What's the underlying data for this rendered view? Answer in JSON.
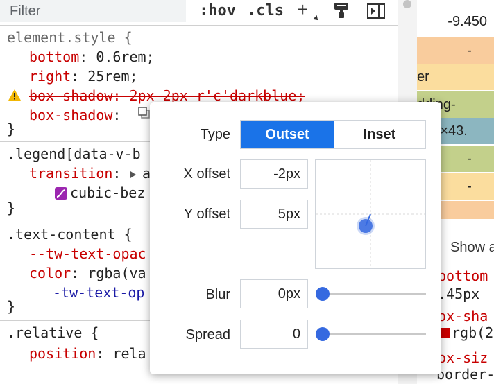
{
  "toolbar": {
    "filter_placeholder": "Filter",
    "hov_label": ":hov",
    "cls_label": ".cls",
    "add_label": "+"
  },
  "styles": {
    "element_style": {
      "selector": "element.style {",
      "bottom_prop": "bottom",
      "bottom_val": ": 0.6rem;",
      "right_prop": "right",
      "right_val": ": 25rem;",
      "invalid_text": "box-shadow: 2px 2px r'c'darkblue;",
      "box_shadow_prop": "box-shadow",
      "box_shadow_colon": ":",
      "close": "}"
    },
    "legend": {
      "selector": ".legend[data-v-b",
      "transition_prop": "transition",
      "transition_colon": ":",
      "transition_val_a": "a",
      "bezier_text": "cubic-bez",
      "close": "}"
    },
    "text_content": {
      "selector": ".text-content {",
      "var_prop": "--tw-text-opac",
      "color_prop": "color",
      "color_val": ": rgba(va",
      "var_ref": "-tw-text-op",
      "close": "}"
    },
    "relative": {
      "selector": ".relative {",
      "position_prop": "position",
      "position_val": ": rela"
    }
  },
  "computed": {
    "rows": [
      "-9.450",
      "-",
      "er",
      "dding",
      "148×43.",
      "-",
      "-",
      "-"
    ],
    "show_all": "Show a",
    "bottom_label": "bottom",
    "bottom_value": ".45px",
    "box_shadow_label": "ox-sha",
    "rgb_value": "rgb(2",
    "box_sizing_label": "ox-siz",
    "border_value": "border-"
  },
  "shadow_editor": {
    "type_label": "Type",
    "outset_label": "Outset",
    "inset_label": "Inset",
    "x_offset_label": "X offset",
    "x_offset_value": "-2px",
    "y_offset_label": "Y offset",
    "y_offset_value": "5px",
    "blur_label": "Blur",
    "blur_value": "0px",
    "spread_label": "Spread",
    "spread_value": "0",
    "selected_type": "Outset"
  },
  "colors": {
    "accent": "#1a73e8",
    "property": "#c80000",
    "variable": "#1a1aa6",
    "margin_box": "#f9cc9d",
    "border_box": "#fbdd9e",
    "padding_box": "#c3d08b",
    "content_box": "#8cb6c0"
  }
}
